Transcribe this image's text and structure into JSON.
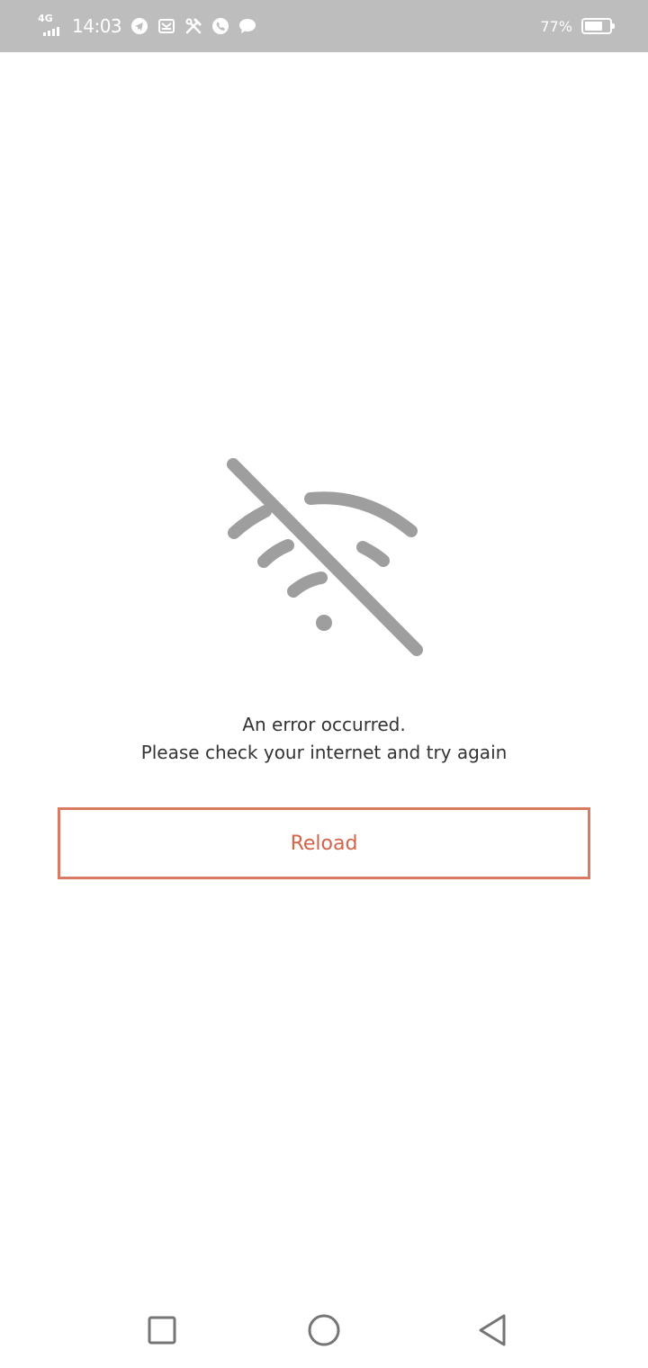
{
  "status_bar": {
    "network_type": "4G",
    "time": "14:03",
    "notification_icons": [
      "telegram-icon",
      "mail-icon",
      "tools-icon",
      "phone-icon",
      "chat-icon"
    ],
    "battery_percent": "77%",
    "battery_level": 0.77
  },
  "error": {
    "icon": "wifi-off-icon",
    "line1": "An error occurred.",
    "line2": "Please check your internet and try again"
  },
  "actions": {
    "reload_label": "Reload"
  },
  "nav_bar": {
    "buttons": [
      "recent-apps",
      "home",
      "back"
    ]
  },
  "colors": {
    "status_bar_bg": "#bdbdbd",
    "accent": "#d97a63",
    "icon_gray": "#9e9e9e"
  }
}
